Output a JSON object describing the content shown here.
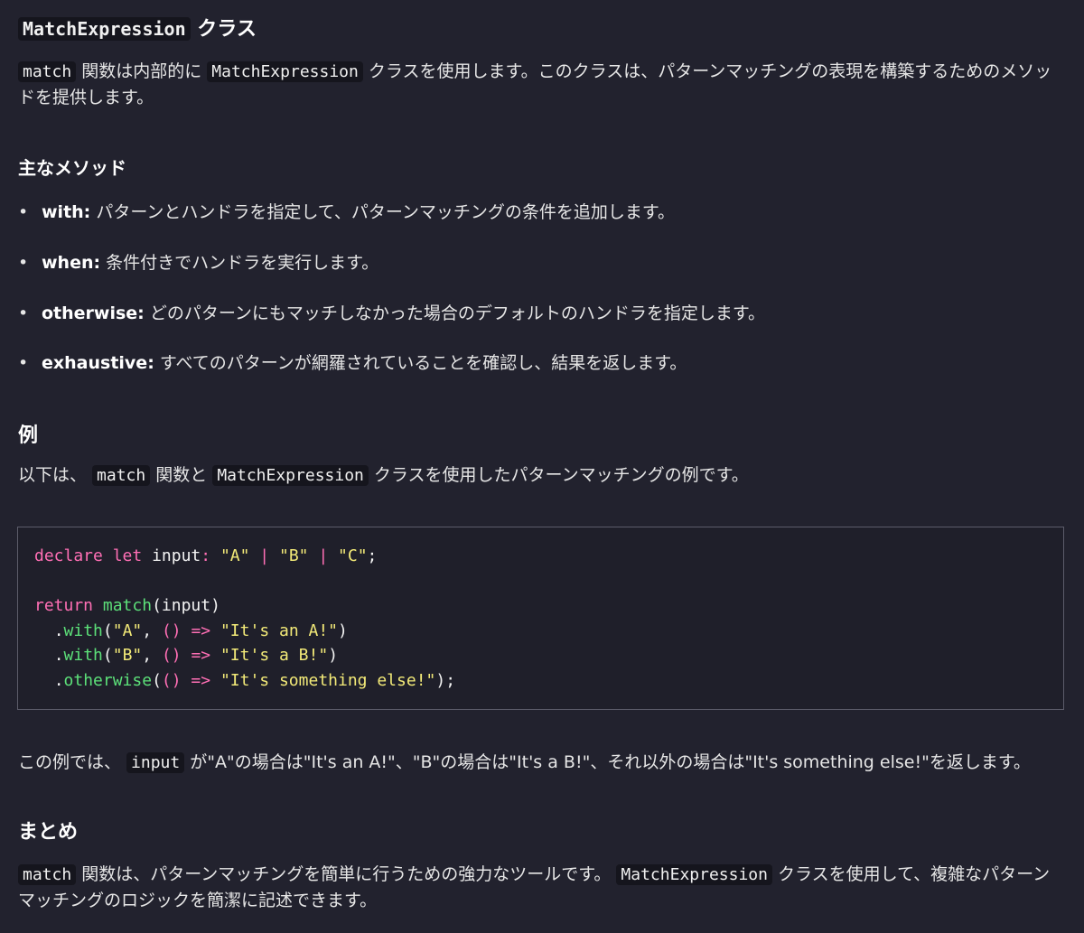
{
  "section": {
    "title_code": "MatchExpression",
    "title_suffix": " クラス",
    "intro": {
      "code1": "match",
      "text1": " 関数は内部的に ",
      "code2": "MatchExpression",
      "text2": " クラスを使用します。このクラスは、パターンマッチングの表現を構築するためのメソッドを提供します。"
    }
  },
  "methods": {
    "title": "主なメソッド",
    "items": [
      {
        "term": "with:",
        "desc": " パターンとハンドラを指定して、パターンマッチングの条件を追加します。"
      },
      {
        "term": "when:",
        "desc": " 条件付きでハンドラを実行します。"
      },
      {
        "term": "otherwise:",
        "desc": " どのパターンにもマッチしなかった場合のデフォルトのハンドラを指定します。"
      },
      {
        "term": "exhaustive:",
        "desc": " すべてのパターンが網羅されていることを確認し、結果を返します。"
      }
    ],
    "bullet": "•"
  },
  "example": {
    "title": "例",
    "intro": {
      "text1": "以下は、 ",
      "code1": "match",
      "text2": " 関数と ",
      "code2": "MatchExpression",
      "text3": " クラスを使用したパターンマッチングの例です。"
    },
    "code": {
      "l1": {
        "kw1": "declare",
        "kw2": "let",
        "ident": "input",
        "colon": ":",
        "s1": "\"A\"",
        "bar1": "|",
        "s2": "\"B\"",
        "bar2": "|",
        "s3": "\"C\"",
        "semi": ";"
      },
      "l3": {
        "kw": "return",
        "fn": "match",
        "args": "(input)"
      },
      "l4": {
        "dot": ".",
        "fn": "with",
        "open": "(",
        "s1": "\"A\"",
        "comma": ",",
        "arrow": "() =>",
        "s2": "\"It's an A!\"",
        "close": ")"
      },
      "l5": {
        "dot": ".",
        "fn": "with",
        "open": "(",
        "s1": "\"B\"",
        "comma": ",",
        "arrow": "() =>",
        "s2": "\"It's a B!\"",
        "close": ")"
      },
      "l6": {
        "dot": ".",
        "fn": "otherwise",
        "open": "(",
        "arrow": "() =>",
        "s2": "\"It's something else!\"",
        "close": ");"
      }
    },
    "explain": {
      "text1": "この例では、 ",
      "code1": "input",
      "text2": " が\"A\"の場合は\"It's an A!\"、\"B\"の場合は\"It's a B!\"、それ以外の場合は\"It's something else!\"を返します。"
    }
  },
  "summary": {
    "title": "まとめ",
    "code1": "match",
    "text1": " 関数は、パターンマッチングを簡単に行うための強力なツールです。 ",
    "code2": "MatchExpression",
    "text2": " クラスを使用して、複雑なパターンマッチングのロジックを簡潔に記述できます。"
  }
}
